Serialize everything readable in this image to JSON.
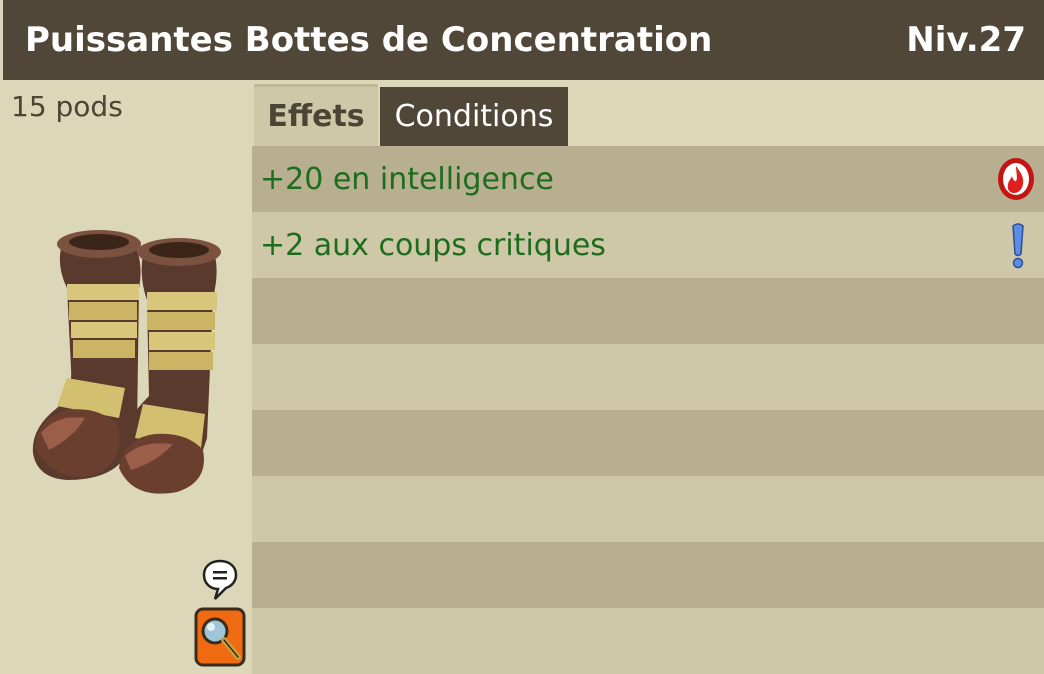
{
  "item": {
    "name": "Puissantes Bottes de Concentration",
    "level": "Niv.27",
    "weight": "15 pods",
    "image_icon": "boots-icon"
  },
  "tabs": [
    {
      "label": "Effets",
      "active": true
    },
    {
      "label": "Conditions",
      "active": false
    }
  ],
  "effects": [
    {
      "text": "+20 en intelligence",
      "icon": "fire-element-icon"
    },
    {
      "text": "+2 aux coups critiques",
      "icon": "exclamation-icon"
    }
  ],
  "actions": {
    "chat_icon": "speech-bubble-icon",
    "search_icon": "magnifier-icon"
  },
  "colors": {
    "title_bar": "#514739",
    "background": "#dcd7b9",
    "row_dark": "#b8af90",
    "row_light": "#cfc8a8",
    "effect_text": "#1d6d1d",
    "search_button": "#ef6a10"
  }
}
